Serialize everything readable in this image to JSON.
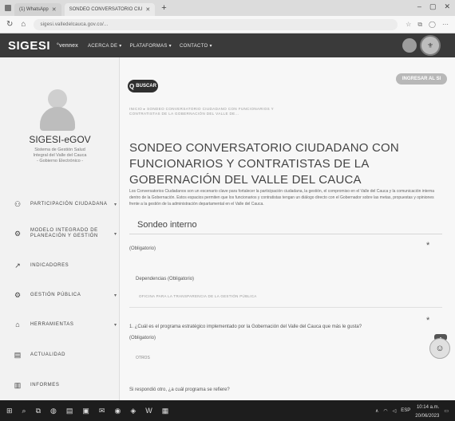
{
  "browser": {
    "tabs": [
      {
        "label": "(1) WhatsApp",
        "active": false
      },
      {
        "label": "SONDEO CONVERSATORIO CIU",
        "active": true
      }
    ],
    "new_tab": "+",
    "url": "sigesi.valledelcauca.gov.co/..."
  },
  "site": {
    "logo": "SIGESI",
    "brand": "°vennex",
    "nav": [
      "ACERCA DE ▾",
      "PLATAFORMAS ▾",
      "CONTACTO ▾"
    ]
  },
  "sidebar": {
    "org_name": "SIGESI-eGOV",
    "org_sub": [
      "Sistema de Gestión Salud",
      "Integral del Valle del Cauca",
      "- Gobierno Electrónico -"
    ],
    "items": [
      {
        "icon": "people-icon",
        "glyph": "⚇",
        "label": "PARTICIPACIÓN CIUDADANA",
        "caret": "▾"
      },
      {
        "icon": "gears-icon",
        "glyph": "⚙",
        "label": "MODELO INTEGRADO DE PLANEACIÓN Y GESTIÓN",
        "caret": "▾"
      },
      {
        "icon": "chart-icon",
        "glyph": "↗",
        "label": "INDICADORES",
        "caret": ""
      },
      {
        "icon": "public-management-icon",
        "glyph": "⚙",
        "label": "GESTIÓN PÚBLICA",
        "caret": "▾"
      },
      {
        "icon": "tools-icon",
        "glyph": "⌂",
        "label": "HERRAMIENTAS",
        "caret": "▾"
      },
      {
        "icon": "news-icon",
        "glyph": "▤",
        "label": "ACTUALIDAD",
        "caret": ""
      },
      {
        "icon": "report-icon",
        "glyph": "▥",
        "label": "INFORMES",
        "caret": ""
      }
    ]
  },
  "main": {
    "search_label": "BUSCAR",
    "login_label": "INGRESAR AL SI",
    "breadcrumb": "INICIO ▸ SONDEO CONVERSATORIO CIUDADANO CON FUNCIONARIOS Y CONTRATISTAS DE LA GOBERNACIÓN DEL VALLE DE...",
    "title": "SONDEO CONVERSATORIO CIUDADANO CON FUNCIONARIOS Y CONTRATISTAS DE LA GOBERNACIÓN DEL VALLE DEL CAUCA",
    "intro": "Los Conversatorios Ciudadanos son un escenario clave para fortalecer la participación ciudadana, la gestión, el compromiso en el Valle del Cauca y la comunicación interna dentro de la Gobernación. Estos espacios permiten que los funcionarios y contratistas tengan un diálogo directo con el Gobernador sobre las metas, propuestas y opiniones frente a la gestión de la administración departamental en el Valle del Cauca.",
    "section_title": "Sondeo interno",
    "obligatorio": "(Obligatorio)",
    "dependencias_label": "Dependencias (Obligatorio)",
    "dependencias_value": "OFICINA PARA LA TRANSPARENCIA DE LA GESTIÓN PÚBLICA",
    "q1": "1. ¿Cuál es el programa estratégico implementado por la Gobernación del Valle del Cauca que más le gusta?",
    "q1_required": "(Obligatorio)",
    "q1_answer": "OTROS",
    "q2": "Si respondió otro, ¿a cuál programa se refiere?",
    "star": "*"
  },
  "taskbar": {
    "clock_time": "10:14 a.m.",
    "clock_date": "20/06/2023"
  }
}
